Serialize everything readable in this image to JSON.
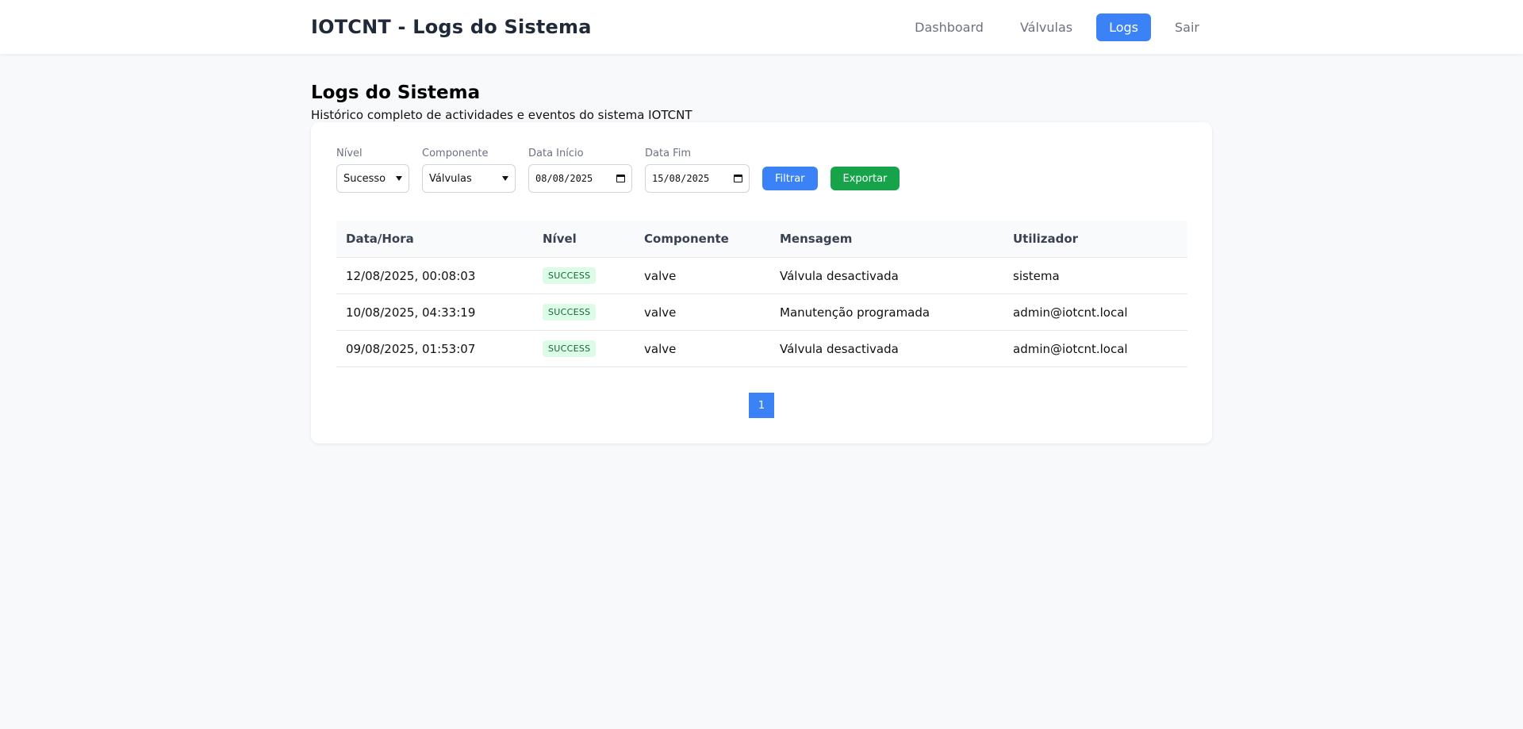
{
  "app": {
    "brand": "IOTCNT - Logs do Sistema"
  },
  "nav": {
    "items": [
      {
        "label": "Dashboard",
        "active": false
      },
      {
        "label": "Válvulas",
        "active": false
      },
      {
        "label": "Logs",
        "active": true
      },
      {
        "label": "Sair",
        "active": false
      }
    ]
  },
  "page": {
    "title": "Logs do Sistema",
    "subtitle": "Histórico completo de actividades e eventos do sistema IOTCNT"
  },
  "filters": {
    "level": {
      "label": "Nível",
      "value": "Sucesso"
    },
    "component": {
      "label": "Componente",
      "value": "Válvulas"
    },
    "start_date": {
      "label": "Data Início",
      "value": "08/08/2025"
    },
    "end_date": {
      "label": "Data Fim",
      "value": "15/08/2025"
    },
    "filter_button": "Filtrar",
    "export_button": "Exportar"
  },
  "table": {
    "headers": [
      "Data/Hora",
      "Nível",
      "Componente",
      "Mensagem",
      "Utilizador"
    ],
    "rows": [
      {
        "datetime": "12/08/2025, 00:08:03",
        "level": "SUCCESS",
        "component": "valve",
        "message": "Válvula desactivada",
        "user": "sistema"
      },
      {
        "datetime": "10/08/2025, 04:33:19",
        "level": "SUCCESS",
        "component": "valve",
        "message": "Manutenção programada",
        "user": "admin@iotcnt.local"
      },
      {
        "datetime": "09/08/2025, 01:53:07",
        "level": "SUCCESS",
        "component": "valve",
        "message": "Válvula desactivada",
        "user": "admin@iotcnt.local"
      }
    ]
  },
  "pagination": {
    "current": "1"
  },
  "colors": {
    "primary": "#3b82f6",
    "success": "#16a34a",
    "badge_bg": "#dcfce7",
    "badge_text": "#166534"
  }
}
